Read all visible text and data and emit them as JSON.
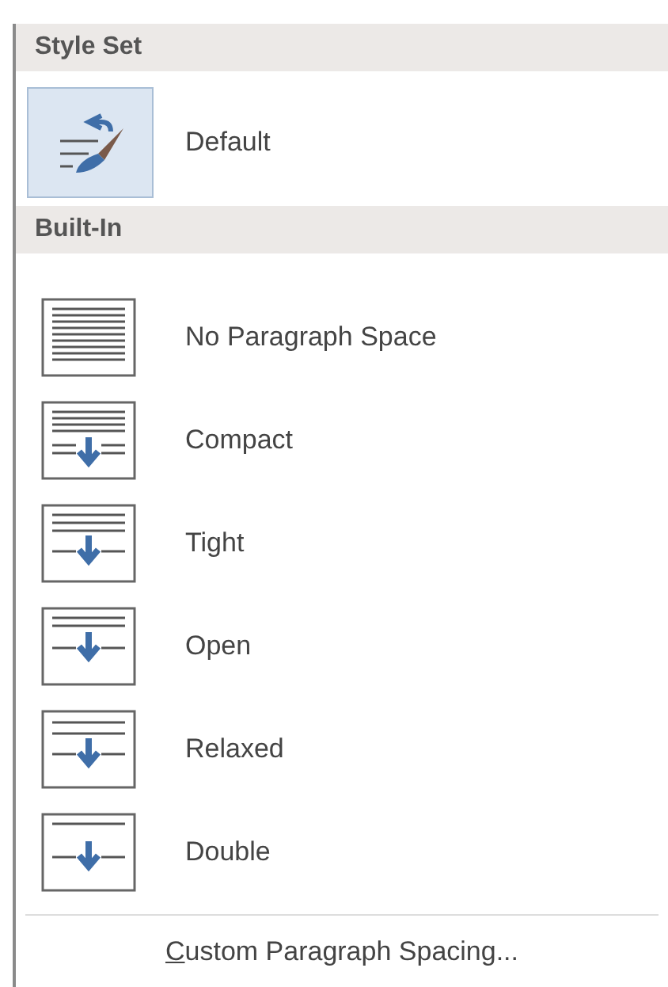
{
  "sections": [
    {
      "header": "Style Set",
      "items": [
        {
          "label": "Default",
          "kind": "default",
          "selected": true
        }
      ]
    },
    {
      "header": "Built-In",
      "items": [
        {
          "label": "No Paragraph Space",
          "kind": "none",
          "selected": false
        },
        {
          "label": "Compact",
          "kind": "compact",
          "selected": false
        },
        {
          "label": "Tight",
          "kind": "tight",
          "selected": false
        },
        {
          "label": "Open",
          "kind": "open",
          "selected": false
        },
        {
          "label": "Relaxed",
          "kind": "relaxed",
          "selected": false
        },
        {
          "label": "Double",
          "kind": "double",
          "selected": false
        }
      ]
    }
  ],
  "footer": {
    "label": "Custom Paragraph Spacing..."
  }
}
